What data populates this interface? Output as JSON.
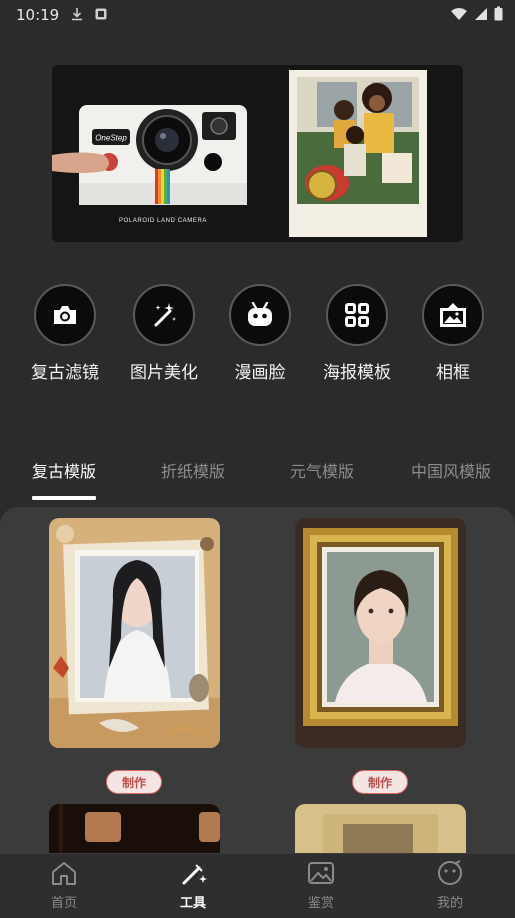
{
  "status_bar": {
    "time": "10:19"
  },
  "banner": {
    "camera_badge": "OneStep",
    "camera_model": "POLAROID LAND CAMERA"
  },
  "tools": [
    {
      "label": "复古滤镜",
      "icon": "camera-icon"
    },
    {
      "label": "图片美化",
      "icon": "magic-wand-icon"
    },
    {
      "label": "漫画脸",
      "icon": "robot-face-icon"
    },
    {
      "label": "海报模板",
      "icon": "grid-icon"
    },
    {
      "label": "相框",
      "icon": "picture-frame-icon"
    }
  ],
  "tabs": [
    {
      "label": "复古模版",
      "active": true
    },
    {
      "label": "折纸模版",
      "active": false
    },
    {
      "label": "元气模版",
      "active": false
    },
    {
      "label": "中国风模版",
      "active": false
    }
  ],
  "templates": [
    {
      "make_label": "制作"
    },
    {
      "make_label": "制作"
    }
  ],
  "bottom_nav": [
    {
      "label": "首页",
      "icon": "home-icon",
      "active": false
    },
    {
      "label": "工具",
      "icon": "tools-wand-icon",
      "active": true
    },
    {
      "label": "鉴赏",
      "icon": "gallery-icon",
      "active": false
    },
    {
      "label": "我的",
      "icon": "profile-face-icon",
      "active": false
    }
  ],
  "colors": {
    "accent": "#e06a6a",
    "background": "#2b2b2b",
    "panel": "#3b3b3b"
  }
}
